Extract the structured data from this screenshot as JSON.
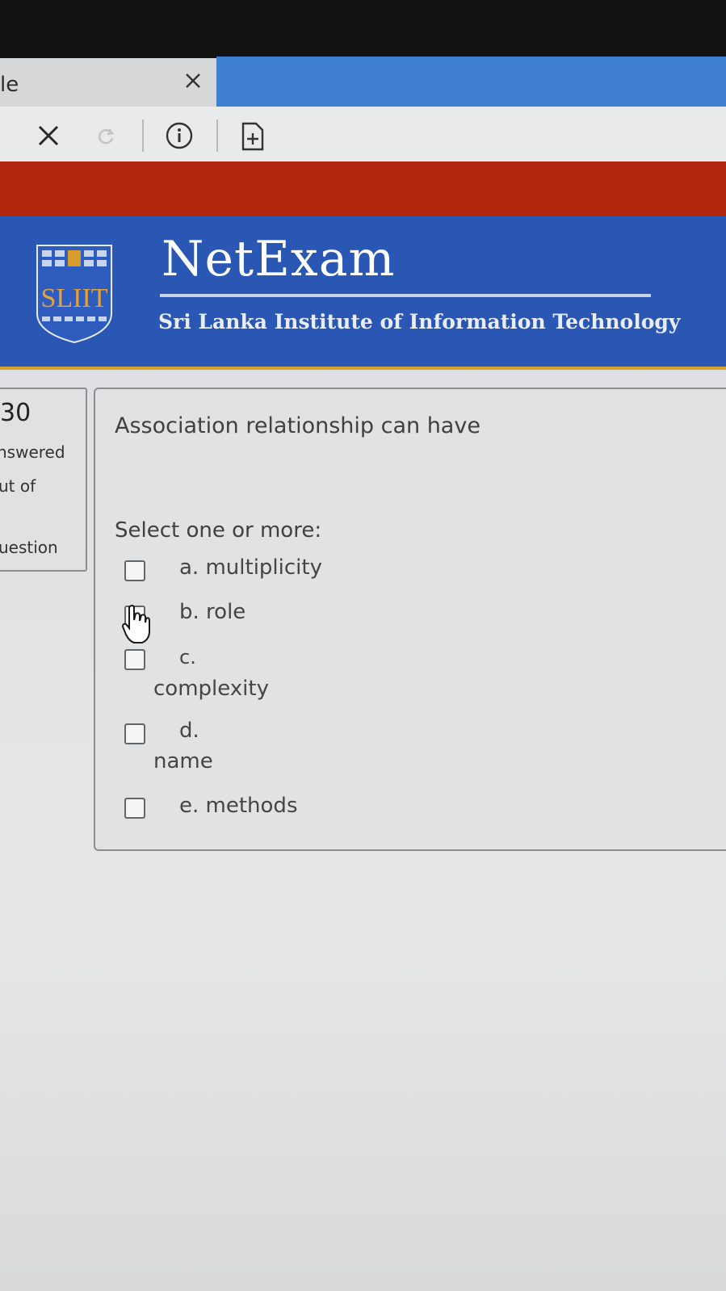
{
  "browser": {
    "tab_title_fragment": "le",
    "icons": [
      "close-icon",
      "stop-icon",
      "reload-icon",
      "info-icon",
      "add-page-icon"
    ]
  },
  "header": {
    "logo_text": "SLIIT",
    "title": "NetExam",
    "subtitle": "Sri Lanka Institute of Information Technology",
    "colors": {
      "red_band": "#b3260e",
      "header_blue": "#2b57b4",
      "gold_rule": "#d7a12a",
      "tab_blue": "#3f7fd1"
    }
  },
  "sidebar": {
    "number": "30",
    "line1": "nswered",
    "line2": "ut of",
    "line3": "uestion"
  },
  "question": {
    "text": "Association relationship can have",
    "prompt": "Select one or more:",
    "options": [
      {
        "letter": "a.",
        "text": "multiplicity",
        "checked": false
      },
      {
        "letter": "b.",
        "text": "role",
        "checked": false
      },
      {
        "letter": "c.",
        "text": "complexity",
        "checked": false
      },
      {
        "letter": "d.",
        "text": "name",
        "checked": false
      },
      {
        "letter": "e.",
        "text": "methods",
        "checked": false
      }
    ]
  }
}
